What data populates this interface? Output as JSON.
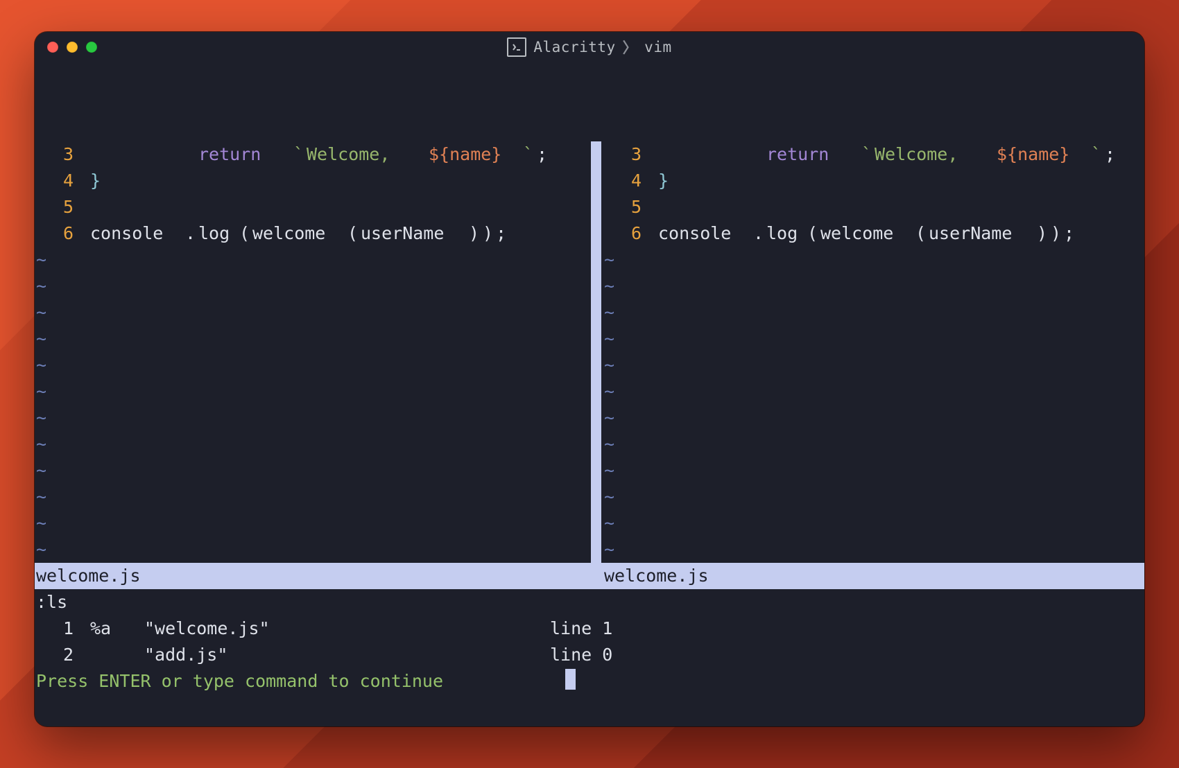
{
  "titlebar": {
    "app": "Alacritty",
    "sub": "vim",
    "sep": "〉"
  },
  "geometry": {
    "cols_total": 82,
    "left_cols": 41,
    "split_col": 41,
    "right_start_col": 42,
    "right_cols": 40,
    "tilde_rows": 12,
    "cell_w": 19.5,
    "left_pad": 2
  },
  "code": [
    {
      "n": "3",
      "gutter_col": 2,
      "text_col": 4,
      "tokens": [
        {
          "t": "        ",
          "c": ""
        },
        {
          "t": "return",
          "c": "c-kw"
        },
        {
          "t": " ",
          "c": ""
        },
        {
          "t": "`",
          "c": "c-bt"
        },
        {
          "t": "Welcome, ",
          "c": "c-str"
        },
        {
          "t": "${name}",
          "c": "c-interp"
        },
        {
          "t": "`",
          "c": "c-bt"
        },
        {
          "t": ";",
          "c": "c-punct"
        }
      ]
    },
    {
      "n": "4",
      "gutter_col": 2,
      "text_col": 4,
      "tokens": [
        {
          "t": "}",
          "c": "c-brace"
        }
      ]
    },
    {
      "n": "5",
      "gutter_col": 2,
      "text_col": 4,
      "tokens": []
    },
    {
      "n": "6",
      "gutter_col": 2,
      "text_col": 4,
      "tokens": [
        {
          "t": "console",
          "c": "c-ident"
        },
        {
          "t": ".",
          "c": "c-punct"
        },
        {
          "t": "log",
          "c": "c-ident"
        },
        {
          "t": "(",
          "c": "c-punct"
        },
        {
          "t": "welcome",
          "c": "c-ident"
        },
        {
          "t": "(",
          "c": "c-punct"
        },
        {
          "t": "userName",
          "c": "c-ident"
        },
        {
          "t": ")",
          "c": "c-punct"
        },
        {
          "t": ")",
          "c": "c-punct"
        },
        {
          "t": ";",
          "c": "c-punct"
        }
      ]
    }
  ],
  "statusline": {
    "left_file": "welcome.js",
    "right_file": "welcome.js"
  },
  "bottom": {
    "cmd": ":ls",
    "buffers": [
      {
        "num": "1",
        "flags": "%a",
        "name": "\"welcome.js\"",
        "line_label": "line",
        "line": "1"
      },
      {
        "num": "2",
        "flags": "",
        "name": "\"add.js\"",
        "line_label": "line",
        "line": "0"
      }
    ],
    "prompt": "Press ENTER or type command to continue"
  }
}
